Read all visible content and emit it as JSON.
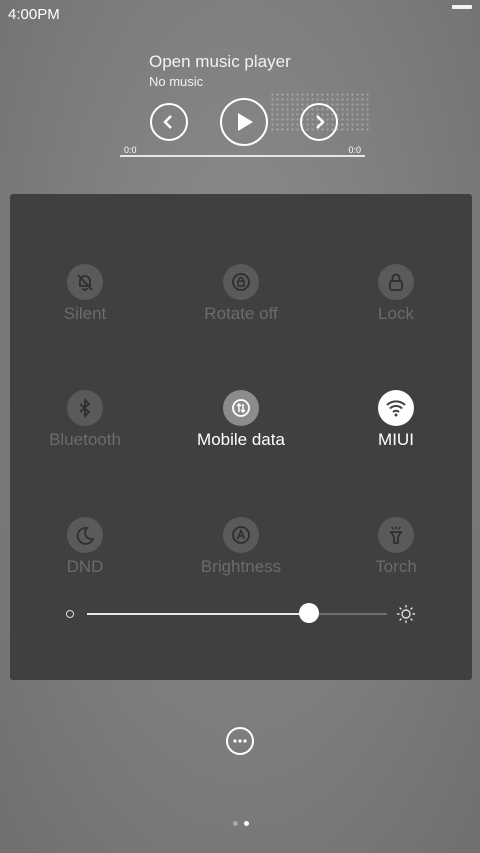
{
  "status": {
    "time": "4:00PM"
  },
  "music": {
    "title": "Open music player",
    "subtitle": "No music",
    "time_start": "0:0",
    "time_end": "0:0"
  },
  "tiles": [
    {
      "label": "Silent",
      "icon": "bell-off-icon",
      "state": "off"
    },
    {
      "label": "Rotate off",
      "icon": "rotate-lock-icon",
      "state": "off"
    },
    {
      "label": "Lock",
      "icon": "lock-icon",
      "state": "off"
    },
    {
      "label": "Bluetooth",
      "icon": "bluetooth-icon",
      "state": "off"
    },
    {
      "label": "Mobile data",
      "icon": "mobile-data-icon",
      "state": "on"
    },
    {
      "label": "MIUI",
      "icon": "wifi-icon",
      "state": "on"
    },
    {
      "label": "DND",
      "icon": "moon-icon",
      "state": "off"
    },
    {
      "label": "Brightness",
      "icon": "auto-brightness-icon",
      "state": "off"
    },
    {
      "label": "Torch",
      "icon": "flashlight-icon",
      "state": "off"
    }
  ],
  "brightness": {
    "level": 0.74
  },
  "pager": {
    "count": 2,
    "current": 2
  },
  "colors": {
    "panel": "#404040",
    "active_text": "#ffffff",
    "inactive_text": "#6b6b6b"
  }
}
